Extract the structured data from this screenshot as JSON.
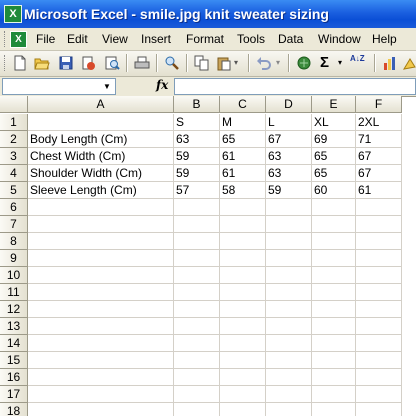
{
  "window": {
    "title": "Microsoft Excel - smile.jpg knit sweater sizing",
    "app_icon": "excel-icon"
  },
  "menu": [
    "File",
    "Edit",
    "View",
    "Insert",
    "Format",
    "Tools",
    "Data",
    "Window",
    "Help"
  ],
  "toolbar": {
    "icons": [
      "new-icon",
      "open-icon",
      "save-icon",
      "permission-icon",
      "print-preview-icon",
      "print-icon",
      "research-icon",
      "copy-icon",
      "paste-icon",
      "undo-icon",
      "hyperlink-icon",
      "autosum-icon",
      "sort-ascending-icon",
      "chart-wizard-icon",
      "drawing-icon"
    ],
    "sigma": "Σ",
    "sort": "A↓Z"
  },
  "formula_bar": {
    "name_box": "",
    "fx_label": "fx",
    "formula": ""
  },
  "sheet": {
    "columns": [
      "A",
      "B",
      "C",
      "D",
      "E",
      "F"
    ],
    "rows": [
      [
        "",
        "S",
        "M",
        "L",
        "XL",
        "2XL"
      ],
      [
        "Body Length (Cm)",
        "63",
        "65",
        "67",
        "69",
        "71"
      ],
      [
        "Chest Width (Cm)",
        "59",
        "61",
        "63",
        "65",
        "67"
      ],
      [
        "Shoulder Width (Cm)",
        "59",
        "61",
        "63",
        "65",
        "67"
      ],
      [
        "Sleeve Length (Cm)",
        "57",
        "58",
        "59",
        "60",
        "61"
      ],
      [
        "",
        "",
        "",
        "",
        "",
        ""
      ],
      [
        "",
        "",
        "",
        "",
        "",
        ""
      ],
      [
        "",
        "",
        "",
        "",
        "",
        ""
      ],
      [
        "",
        "",
        "",
        "",
        "",
        ""
      ],
      [
        "",
        "",
        "",
        "",
        "",
        ""
      ],
      [
        "",
        "",
        "",
        "",
        "",
        ""
      ],
      [
        "",
        "",
        "",
        "",
        "",
        ""
      ],
      [
        "",
        "",
        "",
        "",
        "",
        ""
      ],
      [
        "",
        "",
        "",
        "",
        "",
        ""
      ],
      [
        "",
        "",
        "",
        "",
        "",
        ""
      ],
      [
        "",
        "",
        "",
        "",
        "",
        ""
      ],
      [
        "",
        "",
        "",
        "",
        "",
        ""
      ],
      [
        "",
        "",
        "",
        "",
        "",
        ""
      ]
    ],
    "row_numbers": [
      "1",
      "2",
      "3",
      "4",
      "5",
      "6",
      "7",
      "8",
      "9",
      "10",
      "11",
      "12",
      "13",
      "14",
      "15",
      "16",
      "17",
      "18"
    ]
  }
}
